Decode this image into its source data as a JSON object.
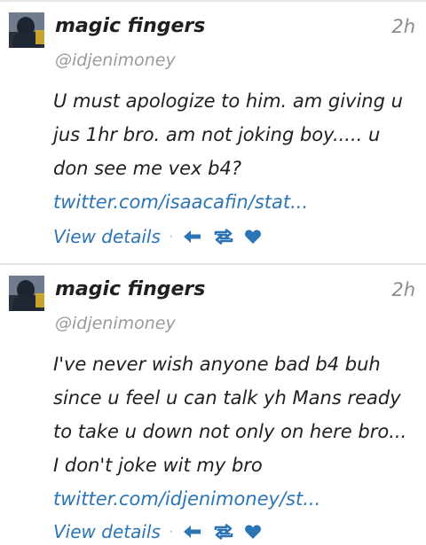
{
  "tweets": [
    {
      "name": "magic fingers",
      "handle": "@idjenimoney",
      "time": "2h",
      "text": "U must apologize to him. am giving u jus 1hr bro. am not joking boy..... u don see me vex b4?",
      "link": "twitter.com/isaacafin/stat...",
      "view_label": "View details",
      "separator": "·"
    },
    {
      "name": "magic fingers",
      "handle": "@idjenimoney",
      "time": "2h",
      "text": "I've never wish anyone bad b4 buh since u feel u can talk yh Mans ready to take u down not only on here bro... I don't joke wit my bro",
      "link": "twitter.com/idjenimoney/st...",
      "view_label": "View details",
      "separator": "·"
    }
  ],
  "icons": {
    "reply": "reply-icon",
    "retweet": "retweet-icon",
    "favorite": "heart-icon"
  },
  "colors": {
    "link": "#2b74b6",
    "muted": "#8c8c8c",
    "text": "#1f1f1f"
  }
}
